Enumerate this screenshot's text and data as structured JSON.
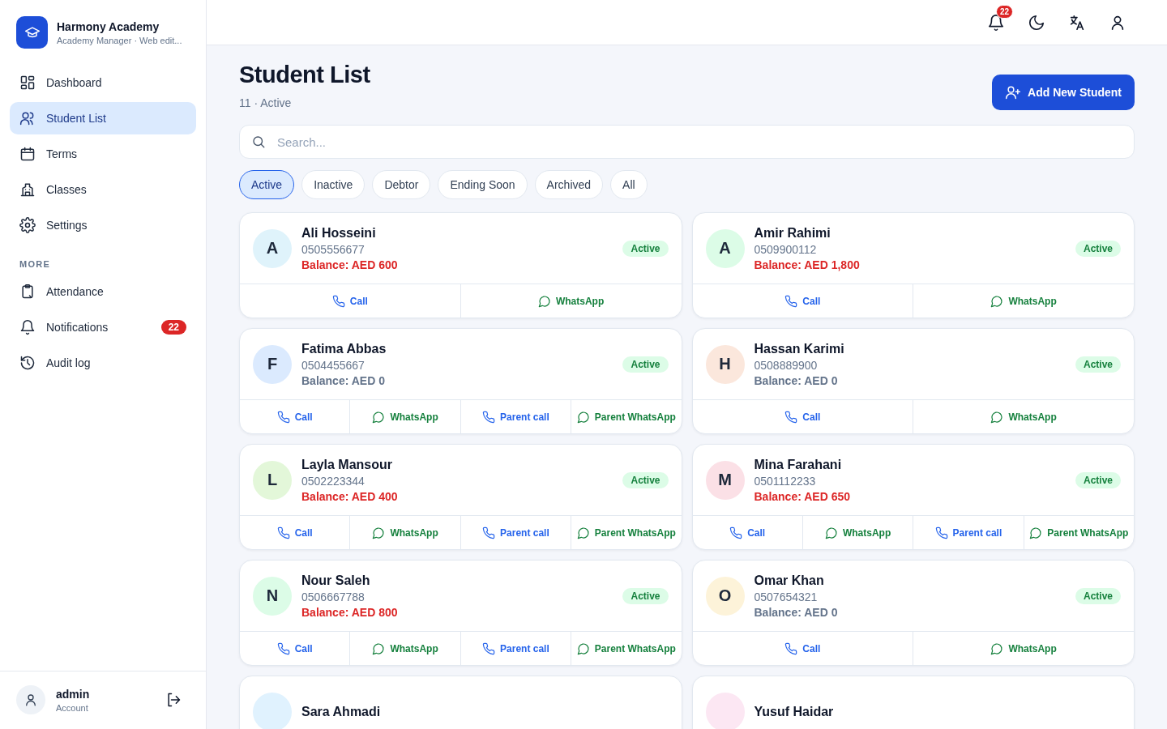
{
  "brand": {
    "name": "Harmony Academy",
    "subtitle": "Academy Manager · Web edit..."
  },
  "sidebar": {
    "items": [
      {
        "label": "Dashboard",
        "selected": false
      },
      {
        "label": "Student List",
        "selected": true
      },
      {
        "label": "Terms",
        "selected": false
      },
      {
        "label": "Classes",
        "selected": false
      },
      {
        "label": "Settings",
        "selected": false
      }
    ],
    "section_label": "MORE",
    "more_items": [
      {
        "label": "Attendance",
        "selected": false
      },
      {
        "label": "Notifications",
        "selected": false,
        "badge": "22"
      },
      {
        "label": "Audit log",
        "selected": false
      }
    ],
    "account": {
      "name": "admin",
      "role": "Account"
    }
  },
  "topbar": {
    "notification_count": "22"
  },
  "page": {
    "title": "Student List",
    "subtitle": "11 · Active",
    "add_button": "Add New Student"
  },
  "search": {
    "placeholder": "Search..."
  },
  "filters": [
    {
      "label": "Active",
      "selected": true
    },
    {
      "label": "Inactive",
      "selected": false
    },
    {
      "label": "Debtor",
      "selected": false
    },
    {
      "label": "Ending Soon",
      "selected": false
    },
    {
      "label": "Archived",
      "selected": false
    },
    {
      "label": "All",
      "selected": false
    }
  ],
  "students": [
    {
      "name": "Ali Hosseini",
      "initial": "A",
      "color": "#dff3fb",
      "phone": "0505556677",
      "balance": "Balance: AED 600",
      "debtor": true,
      "status": "Active",
      "actions": [
        {
          "kind": "call",
          "label": "Call"
        },
        {
          "kind": "whatsapp",
          "label": "WhatsApp"
        }
      ]
    },
    {
      "name": "Amir Rahimi",
      "initial": "A",
      "color": "#dcfce7",
      "phone": "0509900112",
      "balance": "Balance: AED 1,800",
      "debtor": true,
      "status": "Active",
      "actions": [
        {
          "kind": "call",
          "label": "Call"
        },
        {
          "kind": "whatsapp",
          "label": "WhatsApp"
        }
      ]
    },
    {
      "name": "Fatima Abbas",
      "initial": "F",
      "color": "#dbeafe",
      "phone": "0504455667",
      "balance": "Balance: AED 0",
      "debtor": false,
      "status": "Active",
      "actions": [
        {
          "kind": "call",
          "label": "Call"
        },
        {
          "kind": "whatsapp",
          "label": "WhatsApp"
        },
        {
          "kind": "call",
          "label": "Parent call"
        },
        {
          "kind": "whatsapp",
          "label": "Parent WhatsApp"
        }
      ]
    },
    {
      "name": "Hassan Karimi",
      "initial": "H",
      "color": "#fbe7dc",
      "phone": "0508889900",
      "balance": "Balance: AED 0",
      "debtor": false,
      "status": "Active",
      "actions": [
        {
          "kind": "call",
          "label": "Call"
        },
        {
          "kind": "whatsapp",
          "label": "WhatsApp"
        }
      ]
    },
    {
      "name": "Layla Mansour",
      "initial": "L",
      "color": "#e3f7d9",
      "phone": "0502223344",
      "balance": "Balance: AED 400",
      "debtor": true,
      "status": "Active",
      "actions": [
        {
          "kind": "call",
          "label": "Call"
        },
        {
          "kind": "whatsapp",
          "label": "WhatsApp"
        },
        {
          "kind": "call",
          "label": "Parent call"
        },
        {
          "kind": "whatsapp",
          "label": "Parent WhatsApp"
        }
      ]
    },
    {
      "name": "Mina Farahani",
      "initial": "M",
      "color": "#fbe0e6",
      "phone": "0501112233",
      "balance": "Balance: AED 650",
      "debtor": true,
      "status": "Active",
      "actions": [
        {
          "kind": "call",
          "label": "Call"
        },
        {
          "kind": "whatsapp",
          "label": "WhatsApp"
        },
        {
          "kind": "call",
          "label": "Parent call"
        },
        {
          "kind": "whatsapp",
          "label": "Parent WhatsApp"
        }
      ]
    },
    {
      "name": "Nour Saleh",
      "initial": "N",
      "color": "#dcfce7",
      "phone": "0506667788",
      "balance": "Balance: AED 800",
      "debtor": true,
      "status": "Active",
      "actions": [
        {
          "kind": "call",
          "label": "Call"
        },
        {
          "kind": "whatsapp",
          "label": "WhatsApp"
        },
        {
          "kind": "call",
          "label": "Parent call"
        },
        {
          "kind": "whatsapp",
          "label": "Parent WhatsApp"
        }
      ]
    },
    {
      "name": "Omar Khan",
      "initial": "O",
      "color": "#fdf3d9",
      "phone": "0507654321",
      "balance": "Balance: AED 0",
      "debtor": false,
      "status": "Active",
      "actions": [
        {
          "kind": "call",
          "label": "Call"
        },
        {
          "kind": "whatsapp",
          "label": "WhatsApp"
        }
      ]
    },
    {
      "name": "Sara Ahmadi",
      "color": "#e0f2fe"
    },
    {
      "name": "Yusuf Haidar",
      "color": "#fce7f3"
    }
  ]
}
